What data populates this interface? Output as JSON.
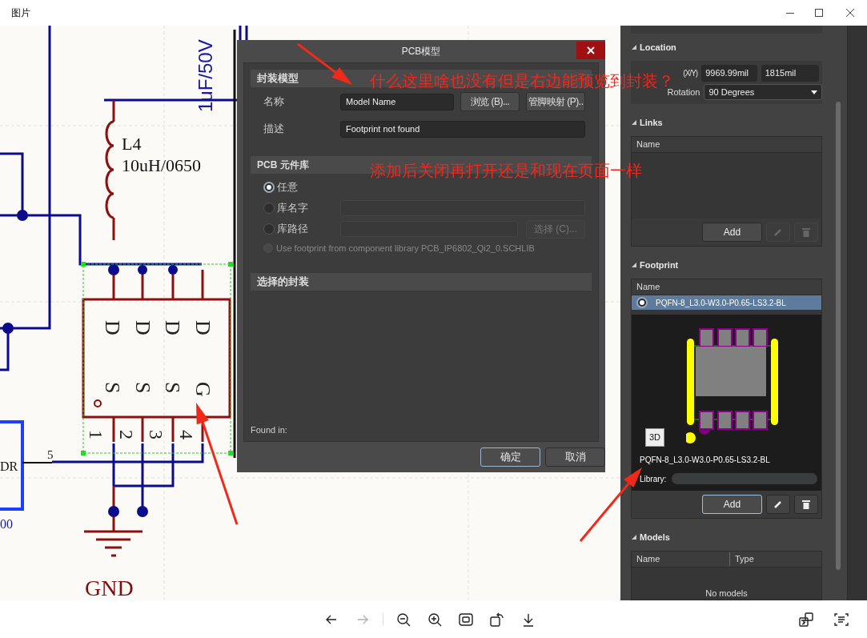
{
  "window": {
    "title": "图片"
  },
  "schematic": {
    "labels": [
      {
        "kind": "value_blue",
        "text": "1uF/50V"
      },
      {
        "kind": "ref",
        "text": "L4"
      },
      {
        "kind": "ref",
        "text": "10uH/0650"
      },
      {
        "kind": "pin_name",
        "text": "D"
      },
      {
        "kind": "pin_name",
        "text": "D"
      },
      {
        "kind": "pin_name",
        "text": "D"
      },
      {
        "kind": "pin_name",
        "text": "D"
      },
      {
        "kind": "pin_name_low",
        "text": "S"
      },
      {
        "kind": "pin_name_low",
        "text": "S"
      },
      {
        "kind": "pin_name_low",
        "text": "S"
      },
      {
        "kind": "pin_name_low",
        "text": "G"
      },
      {
        "kind": "pin_num",
        "text": "1"
      },
      {
        "kind": "pin_num",
        "text": "2"
      },
      {
        "kind": "pin_num",
        "text": "3"
      },
      {
        "kind": "pin_num",
        "text": "4"
      },
      {
        "kind": "small",
        "text": "5"
      },
      {
        "kind": "net",
        "text": "DR"
      },
      {
        "kind": "blue_small",
        "text": "00"
      },
      {
        "kind": "power",
        "text": "GND"
      }
    ]
  },
  "dialog": {
    "title": "PCB模型",
    "model": {
      "heading": "封装模型",
      "fields": [
        {
          "label": "名称",
          "value": "Model Name"
        },
        {
          "label": "描述",
          "value": "Footprint not found"
        }
      ],
      "buttons": [
        "浏览 (B)...",
        "管脚映射 (P).."
      ]
    },
    "library": {
      "heading": "PCB 元件库",
      "options": [
        {
          "label": "任意",
          "selected": true
        },
        {
          "label": "库名字",
          "selected": false
        },
        {
          "label": "库路径",
          "selected": false
        }
      ],
      "choose": {
        "label": "选择 (C)...",
        "disabled": true
      },
      "use_component_library": {
        "label": "Use footprint from component library PCB_IP6802_Qi2_0.SCHLIB",
        "disabled": true
      }
    },
    "selected_heading": "选择的封装",
    "found_in": "Found in:",
    "buttons": [
      {
        "label": "确定",
        "default": true
      },
      {
        "label": "取消",
        "default": false
      }
    ]
  },
  "panel": {
    "location": {
      "heading": "Location",
      "xy_label": "(X/Y)",
      "x": "9969.99mil",
      "y": "1815mil",
      "rotation_label": "Rotation",
      "rotation": "90 Degrees"
    },
    "links": {
      "heading": "Links",
      "column": "Name",
      "add": {
        "label": "Add",
        "focused": false
      },
      "tools_disabled": true
    },
    "footprint": {
      "heading": "Footprint",
      "column": "Name",
      "rows": [
        {
          "name": "PQFN-8_L3.0-W3.0-P0.65-LS3.2-BL",
          "selected": true
        }
      ],
      "view_3d": "3D",
      "preview_name": "PQFN-8_L3.0-W3.0-P0.65-LS3.2-BL",
      "library_label": "Library:",
      "add": {
        "label": "Add",
        "focused": true
      },
      "tools_disabled": false
    },
    "models": {
      "heading": "Models",
      "columns": [
        "Name",
        "Type"
      ],
      "empty": "No models"
    }
  },
  "annotations": [
    "什么这里啥也没有但是右边能预览到封装？",
    "添加后关闭再打开还是和现在页面一样"
  ],
  "toolbar": [
    {
      "kind": "back",
      "disabled": false
    },
    {
      "kind": "forward",
      "disabled": true
    },
    {
      "kind": "zoom_out",
      "disabled": false
    },
    {
      "kind": "zoom_in",
      "disabled": false
    },
    {
      "kind": "fit",
      "disabled": false
    },
    {
      "kind": "rotate",
      "disabled": false
    },
    {
      "kind": "download",
      "disabled": false
    }
  ],
  "toolbar_right": [
    {
      "kind": "translate"
    },
    {
      "kind": "text_scan"
    }
  ]
}
